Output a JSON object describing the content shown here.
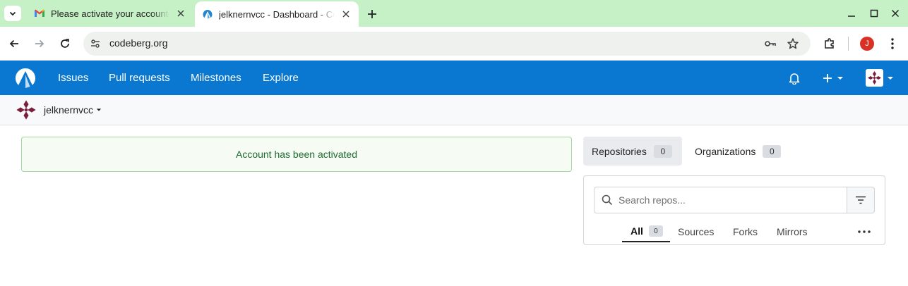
{
  "browser": {
    "tabs": [
      {
        "title": "Please activate your account",
        "favicon": "gmail-icon",
        "active": false
      },
      {
        "title": "jelknernvcc - Dashboard - Codeberg",
        "favicon": "codeberg-icon",
        "active": true
      }
    ],
    "address": "codeberg.org",
    "profile_initial": "J",
    "colors": {
      "tabstrip": "#c6f1c6",
      "omnibox": "#eef1ee",
      "profile": "#d93025"
    }
  },
  "nav": {
    "items": [
      "Issues",
      "Pull requests",
      "Milestones",
      "Explore"
    ],
    "color": "#0a78d1"
  },
  "context": {
    "username": "jelknernvcc"
  },
  "flash": {
    "message": "Account has been activated",
    "color": "#1d6b30"
  },
  "dashboard": {
    "tabs": [
      {
        "label": "Repositories",
        "count": "0"
      },
      {
        "label": "Organizations",
        "count": "0"
      }
    ],
    "search_placeholder": "Search repos...",
    "filters": {
      "all_label": "All",
      "all_count": "0",
      "sources": "Sources",
      "forks": "Forks",
      "mirrors": "Mirrors"
    }
  }
}
